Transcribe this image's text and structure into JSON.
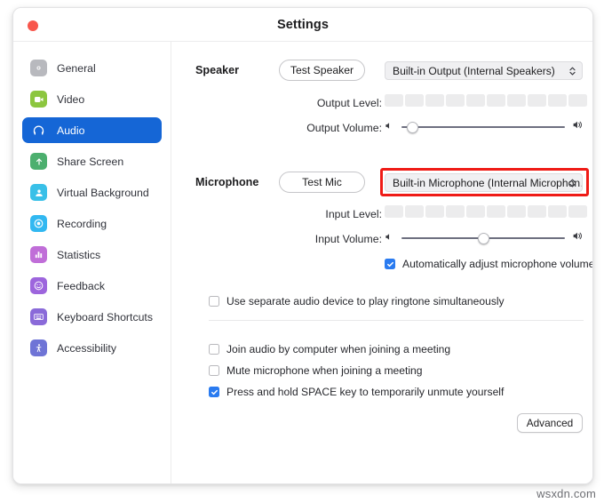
{
  "window": {
    "title": "Settings",
    "close_button": "close"
  },
  "sidebar": {
    "items": [
      {
        "label": "General",
        "icon": "gear-icon",
        "color": "#b8b9be",
        "selected": false
      },
      {
        "label": "Video",
        "icon": "video-camera-icon",
        "color": "#8cc63f",
        "selected": false
      },
      {
        "label": "Audio",
        "icon": "headphones-icon",
        "color": "#1566d6",
        "selected": true
      },
      {
        "label": "Share Screen",
        "icon": "share-screen-icon",
        "color": "#4caf6e",
        "selected": false
      },
      {
        "label": "Virtual Background",
        "icon": "person-frame-icon",
        "color": "#39c0e8",
        "selected": false
      },
      {
        "label": "Recording",
        "icon": "record-circle-icon",
        "color": "#32b8f1",
        "selected": false
      },
      {
        "label": "Statistics",
        "icon": "bar-chart-icon",
        "color": "#c06ed8",
        "selected": false
      },
      {
        "label": "Feedback",
        "icon": "smiley-face-icon",
        "color": "#9d65dd",
        "selected": false
      },
      {
        "label": "Keyboard Shortcuts",
        "icon": "keyboard-icon",
        "color": "#8a6ad9",
        "selected": false
      },
      {
        "label": "Accessibility",
        "icon": "accessibility-icon",
        "color": "#6f74d6",
        "selected": false
      }
    ]
  },
  "speaker": {
    "section_label": "Speaker",
    "test_button": "Test Speaker",
    "device": "Built-in Output (Internal Speakers)",
    "level_label": "Output Level:",
    "level_segments": 10,
    "level_filled": 0,
    "volume_label": "Output Volume:",
    "volume_percent": 3
  },
  "microphone": {
    "section_label": "Microphone",
    "test_button": "Test Mic",
    "device": "Built-in Microphone (Internal Microphon…",
    "device_highlighted": true,
    "highlight_color": "#ef1b16",
    "level_label": "Input Level:",
    "level_segments": 10,
    "level_filled": 0,
    "volume_label": "Input Volume:",
    "volume_percent": 50,
    "auto_adjust": {
      "label": "Automatically adjust microphone volume",
      "checked": true
    }
  },
  "options": {
    "ringtone": {
      "label": "Use separate audio device to play ringtone simultaneously",
      "checked": false
    },
    "join_audio": {
      "label": "Join audio by computer when joining a meeting",
      "checked": false
    },
    "mute_on_join": {
      "label": "Mute microphone when joining a meeting",
      "checked": false
    },
    "push_to_talk": {
      "label": "Press and hold SPACE key to temporarily unmute yourself",
      "checked": true
    }
  },
  "footer": {
    "advanced_button": "Advanced"
  },
  "watermark": "wsxdn.com",
  "colors": {
    "accent": "#1566d6",
    "checkbox": "#2a7bf0",
    "highlight": "#ef1b16",
    "close": "#f8564c"
  }
}
